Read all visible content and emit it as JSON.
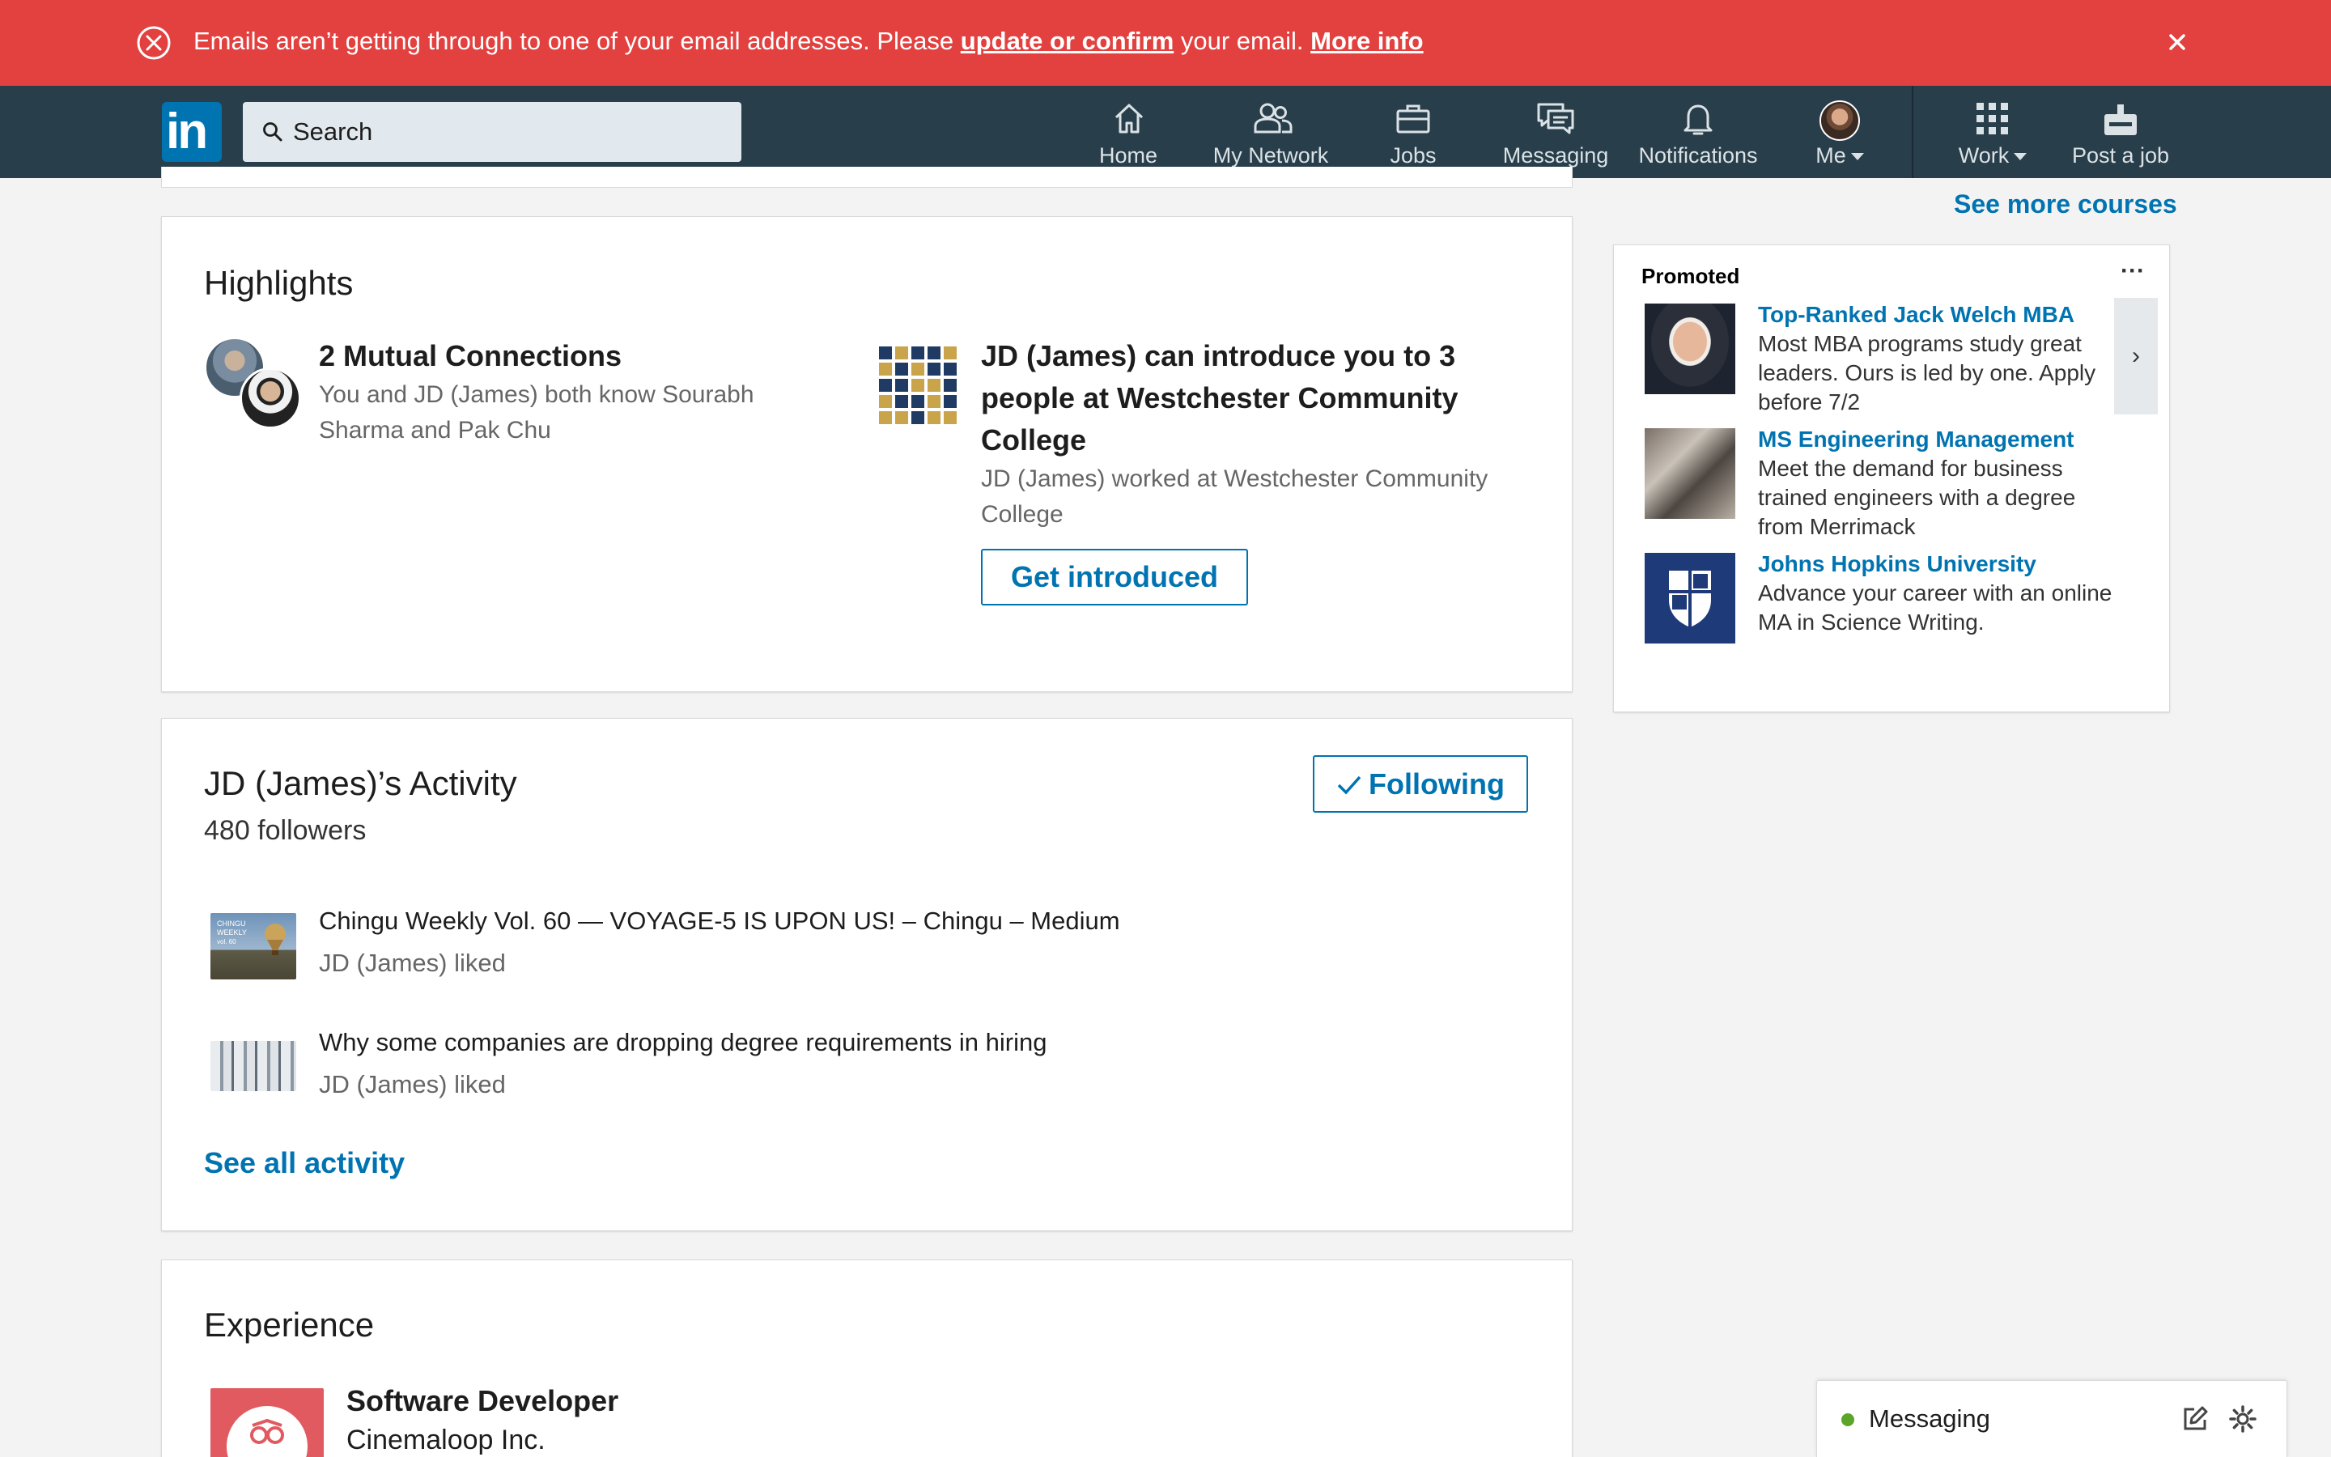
{
  "alert": {
    "text_before": "Emails aren’t getting through to one of your email addresses. Please ",
    "link_update": "update or confirm",
    "text_middle": " your email. ",
    "link_more": "More info"
  },
  "nav": {
    "search_placeholder": "Search",
    "items": [
      {
        "label": "Home",
        "icon": "home-icon"
      },
      {
        "label": "My Network",
        "icon": "my-network-icon"
      },
      {
        "label": "Jobs",
        "icon": "jobs-icon"
      },
      {
        "label": "Messaging",
        "icon": "messaging-icon"
      },
      {
        "label": "Notifications",
        "icon": "notifications-icon"
      },
      {
        "label": "Me",
        "icon": "avatar"
      },
      {
        "label": "Work",
        "icon": "grid-icon"
      },
      {
        "label": "Post a job",
        "icon": "post-job-icon"
      }
    ]
  },
  "highlights": {
    "title": "Highlights",
    "mutual": {
      "title": "2 Mutual Connections",
      "desc": "You and JD (James) both know Sourabh Sharma and Pak Chu"
    },
    "intro": {
      "title": "JD (James) can introduce you to 3 people at Westchester Community College",
      "desc": "JD (James) worked at Westchester Community College",
      "button": "Get introduced"
    }
  },
  "activity": {
    "title": "JD (James)’s Activity",
    "followers": "480 followers",
    "follow_button": "Following",
    "posts": [
      {
        "title": "Chingu Weekly Vol. 60 — VOYAGE-5 IS UPON US! – Chingu – Medium",
        "action": "JD (James) liked"
      },
      {
        "title": "Why some companies are dropping degree requirements in hiring",
        "action": "JD (James) liked"
      }
    ],
    "see_all": "See all activity"
  },
  "experience": {
    "title": "Experience",
    "job_title": "Software Developer",
    "company": "Cinemaloop Inc."
  },
  "sidebar": {
    "see_more_courses": "See more courses",
    "promoted_label": "Promoted",
    "more": "···",
    "ads": [
      {
        "title": "Top-Ranked Jack Welch MBA",
        "desc": "Most MBA programs study great leaders. Ours is led by one. Apply before 7/2"
      },
      {
        "title": "MS Engineering Management",
        "desc": "Meet the demand for business trained engineers with a degree from Merrimack"
      },
      {
        "title": "Johns Hopkins University",
        "desc": "Advance your career with an online MA in Science Writing."
      }
    ],
    "arrow": "›"
  },
  "messaging_bar": {
    "label": "Messaging"
  },
  "colors": {
    "alert_bg": "#e2413f",
    "nav_bg": "#283e4a",
    "brand_blue": "#0073b1",
    "online_green": "#5aa52a"
  }
}
